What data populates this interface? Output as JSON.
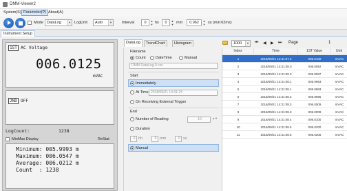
{
  "window": {
    "title": "DMM-Viewer2"
  },
  "menu": {
    "items": [
      "System(S)",
      "Parameter(P)",
      "About(A)"
    ]
  },
  "toolbar": {
    "mode_label": "Mode",
    "mode_value": "DataLog",
    "logunit_label": "LogUnit",
    "logunit_value": "Auto",
    "interval_label": "Interval",
    "hs_value": "0",
    "hs_unit": "hs",
    "mm_value": "0",
    "mm_unit": "mm",
    "ss_value": "0.062",
    "ss_unit": "ss (min:62ms)"
  },
  "tabs": {
    "instrument": "Instrument Setup"
  },
  "display": {
    "primary_tag": "1ST",
    "function": "AC Voltage",
    "value": "006.0125",
    "unit": "mVAC",
    "secondary_tag": "2ND",
    "secondary_state": "OFF",
    "logcount_label": "LogCount:",
    "logcount_value": "1238",
    "minmax_label": "MinMax Display",
    "restat_label": "ReStat",
    "stats": {
      "minimum": "Minimum: 005.9993 m",
      "maximum": "Maximum: 006.0547 m",
      "average": "Average: 006.0212 m",
      "count": "Count  : 1238"
    }
  },
  "view_tabs": [
    "DataLog",
    "TrendChart",
    "Histogram"
  ],
  "config": {
    "filename_title": "Filename",
    "filename_options": [
      "Count",
      "DateTime",
      "Manual"
    ],
    "filename_value": "DMM DataLog-0.csv",
    "start_title": "Start",
    "start_immediately": "Immediately",
    "start_attime": "At Time",
    "start_attime_value": "2018/09/21 14:31:24",
    "start_trigger": "On Receiving External Trigger",
    "end_title": "End",
    "end_number_label": "Number of Reading",
    "end_number_value": "10",
    "end_duration": "Duration",
    "dur_h_value": "0",
    "dur_h_unit": "hh",
    "dur_m_value": "0",
    "dur_m_unit": "mm",
    "dur_s_value": "0",
    "dur_s_unit": "ss",
    "end_manual": "Manual"
  },
  "pager": {
    "page_size": "1000",
    "first": "⏮",
    "prev": "◀",
    "next": "▶",
    "last": "⏭",
    "page_label": "Page",
    "page_value": "1"
  },
  "table": {
    "columns": [
      "Index",
      "Time",
      "1ST Value",
      "Unit"
    ],
    "rows": [
      [
        "1",
        "2018/09/21 14:31:07.2",
        "006.0100",
        "mVAC"
      ],
      [
        "2",
        "2018/09/21 14:31:08.0",
        "006.0092",
        "mVAC"
      ],
      [
        "3",
        "2018/09/21 14:31:08.0",
        "006.0087",
        "mVAC"
      ],
      [
        "4",
        "2018/09/21 14:31:08.1",
        "005.9993",
        "mVAC"
      ],
      [
        "5",
        "2018/09/21 14:31:08.1",
        "005.9983",
        "mVAC"
      ],
      [
        "6",
        "2018/09/21 14:31:08.2",
        "005.9995",
        "mVAC"
      ],
      [
        "7",
        "2018/09/21 14:31:08.3",
        "006.0009",
        "mVAC"
      ],
      [
        "8",
        "2018/09/21 14:31:08.3",
        "006.0009",
        "mVAC"
      ],
      [
        "9",
        "2018/09/21 14:31:08.4",
        "006.0100",
        "mVAC"
      ],
      [
        "10",
        "2018/09/21 14:31:08.5",
        "006.0200",
        "mVAC"
      ],
      [
        "11",
        "2018/09/21 14:31:08.5",
        "006.0205",
        "mVAC"
      ]
    ]
  },
  "colors": {
    "accent": "#2f6fc7",
    "selection_light": "#cde0f5"
  }
}
